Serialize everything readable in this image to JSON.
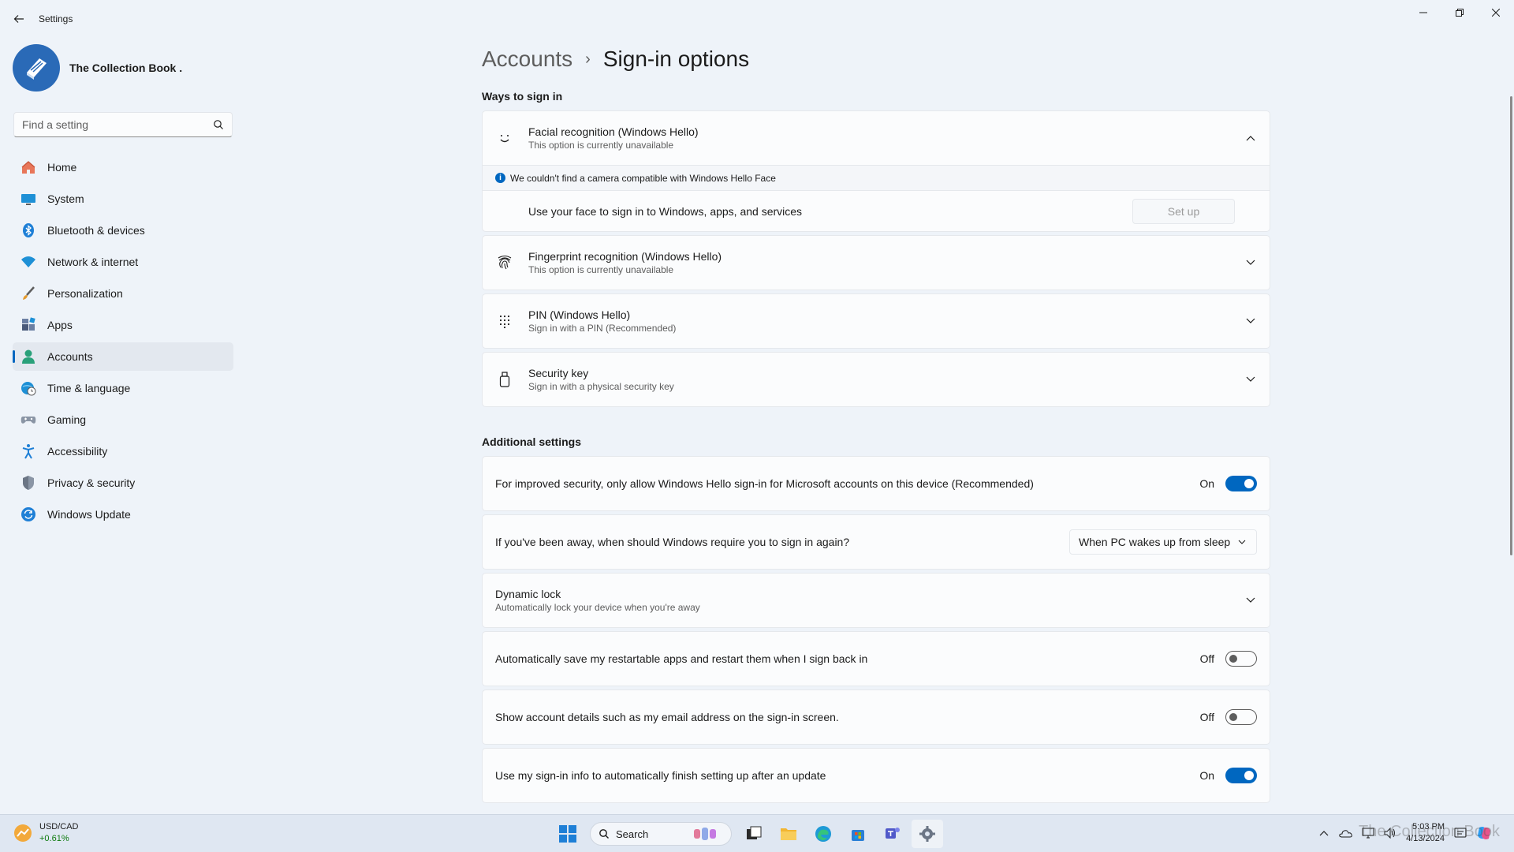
{
  "window": {
    "title": "Settings"
  },
  "profile": {
    "name": "The Collection Book ."
  },
  "search": {
    "placeholder": "Find a setting"
  },
  "nav": [
    {
      "label": "Home",
      "icon": "home-icon"
    },
    {
      "label": "System",
      "icon": "system-icon"
    },
    {
      "label": "Bluetooth & devices",
      "icon": "bluetooth-icon"
    },
    {
      "label": "Network & internet",
      "icon": "wifi-icon"
    },
    {
      "label": "Personalization",
      "icon": "brush-icon"
    },
    {
      "label": "Apps",
      "icon": "apps-icon"
    },
    {
      "label": "Accounts",
      "icon": "person-icon",
      "active": true
    },
    {
      "label": "Time & language",
      "icon": "globe-clock-icon"
    },
    {
      "label": "Gaming",
      "icon": "gamepad-icon"
    },
    {
      "label": "Accessibility",
      "icon": "accessibility-icon"
    },
    {
      "label": "Privacy & security",
      "icon": "shield-icon"
    },
    {
      "label": "Windows Update",
      "icon": "update-icon"
    }
  ],
  "breadcrumb": {
    "parent": "Accounts",
    "separator": "›",
    "current": "Sign-in options"
  },
  "ways": {
    "title": "Ways to sign in",
    "face": {
      "title": "Facial recognition (Windows Hello)",
      "subtitle": "This option is currently unavailable",
      "info": "We couldn't find a camera compatible with Windows Hello Face",
      "use_text": "Use your face to sign in to Windows, apps, and services",
      "setup_label": "Set up"
    },
    "fingerprint": {
      "title": "Fingerprint recognition (Windows Hello)",
      "subtitle": "This option is currently unavailable"
    },
    "pin": {
      "title": "PIN (Windows Hello)",
      "subtitle": "Sign in with a PIN (Recommended)"
    },
    "key": {
      "title": "Security key",
      "subtitle": "Sign in with a physical security key"
    }
  },
  "additional": {
    "title": "Additional settings",
    "hello_only": {
      "text": "For improved security, only allow Windows Hello sign-in for Microsoft accounts on this device (Recommended)",
      "state": "On"
    },
    "away": {
      "text": "If you've been away, when should Windows require you to sign in again?",
      "value": "When PC wakes up from sleep"
    },
    "dynamic_lock": {
      "title": "Dynamic lock",
      "subtitle": "Automatically lock your device when you're away"
    },
    "restart_apps": {
      "text": "Automatically save my restartable apps and restart them when I sign back in",
      "state": "Off"
    },
    "account_details": {
      "text": "Show account details such as my email address on the sign-in screen.",
      "state": "Off"
    },
    "signin_info": {
      "text": "Use my sign-in info to automatically finish setting up after an update",
      "state": "On"
    }
  },
  "taskbar": {
    "widget_title": "USD/CAD",
    "widget_change": "+0.61%",
    "search_label": "Search",
    "time": "5:03 PM",
    "date": "4/13/2024",
    "watermark": "The Collection Book"
  },
  "colors": {
    "accent": "#0067c0",
    "background": "#eef3f9",
    "card": "#fbfcfd"
  }
}
